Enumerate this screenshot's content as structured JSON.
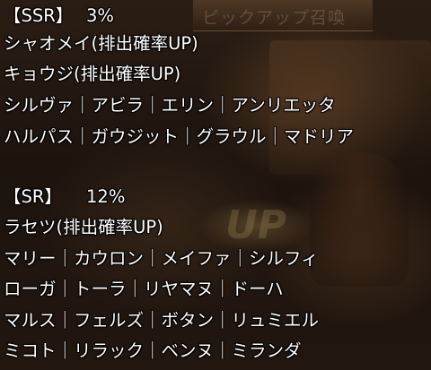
{
  "background": {
    "banner_text": "ピックアップ召喚",
    "up_text": "UP"
  },
  "ssr": {
    "label": "【SSR】",
    "rate": "3%",
    "lines": [
      "シャオメイ(排出確率UP)",
      "キョウジ(排出確率UP)",
      "シルヴァ｜アビラ｜エリン｜アンリエッタ",
      "ハルパス｜ガウジット｜グラウル｜マドリア"
    ]
  },
  "sr": {
    "label": "【SR】",
    "rate": "12%",
    "lines": [
      "ラセツ(排出確率UP)",
      "マリー｜カウロン｜メイファ｜シルフィ",
      "ローガ｜トーラ｜リヤマヌ｜ドーハ",
      "マルス｜フェルズ｜ボタン｜リュミエル",
      "ミコト｜リラック｜ベンヌ｜ミランダ"
    ]
  }
}
